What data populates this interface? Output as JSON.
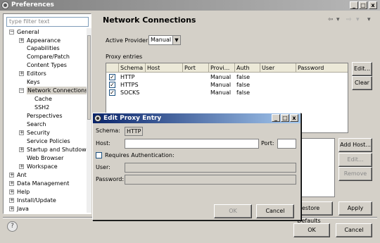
{
  "window": {
    "title": "Preferences",
    "minimize_label": "_",
    "maximize_label": "□",
    "close_label": "x"
  },
  "left": {
    "filter_placeholder": "type filter text",
    "tree": [
      {
        "label": "General",
        "expander": "−"
      },
      {
        "label": "Appearance",
        "expander": "+"
      },
      {
        "label": "Capabilities"
      },
      {
        "label": "Compare/Patch"
      },
      {
        "label": "Content Types"
      },
      {
        "label": "Editors",
        "expander": "+"
      },
      {
        "label": "Keys"
      },
      {
        "label": "Network Connections",
        "expander": "−"
      },
      {
        "label": "Cache"
      },
      {
        "label": "SSH2"
      },
      {
        "label": "Perspectives"
      },
      {
        "label": "Search"
      },
      {
        "label": "Security",
        "expander": "+"
      },
      {
        "label": "Service Policies"
      },
      {
        "label": "Startup and Shutdown",
        "expander": "+"
      },
      {
        "label": "Web Browser"
      },
      {
        "label": "Workspace",
        "expander": "+"
      },
      {
        "label": "Ant",
        "expander": "+"
      },
      {
        "label": "Data Management",
        "expander": "+"
      },
      {
        "label": "Help",
        "expander": "+"
      },
      {
        "label": "Install/Update",
        "expander": "+"
      },
      {
        "label": "Java",
        "expander": "+"
      }
    ]
  },
  "main": {
    "title": "Network Connections",
    "active_provider_label": "Active Provider:",
    "active_provider_value": "Manual",
    "proxy_entries_label": "Proxy entries",
    "columns": [
      "Schema",
      "Host",
      "Port",
      "Provi...",
      "Auth",
      "User",
      "Password"
    ],
    "rows": [
      {
        "checked": "✓",
        "schema": "HTTP",
        "host": "",
        "port": "",
        "provider": "Manual",
        "auth": "false",
        "user": "",
        "password": ""
      },
      {
        "checked": "✓",
        "schema": "HTTPS",
        "host": "",
        "port": "",
        "provider": "Manual",
        "auth": "false",
        "user": "",
        "password": ""
      },
      {
        "checked": "✓",
        "schema": "SOCKS",
        "host": "",
        "port": "",
        "provider": "Manual",
        "auth": "false",
        "user": "",
        "password": ""
      }
    ],
    "edit_button": "Edit...",
    "clear_button": "Clear",
    "add_host_button": "Add Host...",
    "edit2_button": "Edit...",
    "remove_button": "Remove",
    "restore_defaults_button": "Restore Defaults",
    "apply_button": "Apply",
    "ok_button": "OK",
    "cancel_button": "Cancel",
    "help_icon": "?"
  },
  "dialog": {
    "title": "Edit Proxy Entry",
    "schema_label": "Schema:",
    "schema_value": "HTTP",
    "host_label": "Host:",
    "port_label": "Port:",
    "requires_auth_label": "Requires Authentication:",
    "user_label": "User:",
    "password_label": "Password:",
    "ok_button": "OK",
    "cancel_button": "Cancel",
    "minimize_label": "_",
    "maximize_label": "□",
    "close_label": "x"
  }
}
